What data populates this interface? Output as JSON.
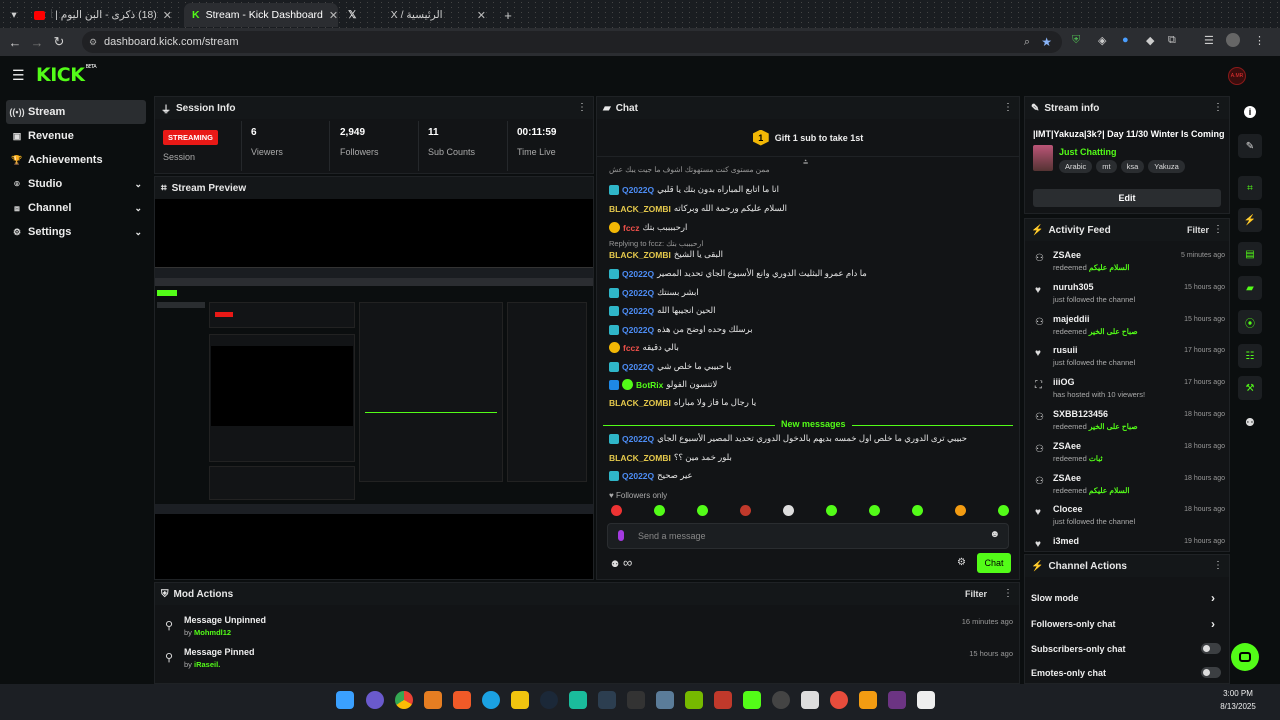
{
  "browser": {
    "tabs": [
      {
        "title": "(18) ذكرى - البن اليوم | ألبوم كامل"
      },
      {
        "title": "Stream - Kick Dashboard"
      },
      {
        "title": "الرئيسية / X"
      }
    ],
    "url": "dashboard.kick.com/stream"
  },
  "app": {
    "logo": "KICK",
    "logo_sup": "BETA",
    "avatar_label": "A.MR"
  },
  "sidebar": {
    "items": [
      {
        "label": "Stream",
        "icon": "radio-icon"
      },
      {
        "label": "Revenue",
        "icon": "wallet-icon"
      },
      {
        "label": "Achievements",
        "icon": "trophy-icon"
      },
      {
        "label": "Studio",
        "icon": "studio-icon"
      },
      {
        "label": "Channel",
        "icon": "channel-icon"
      },
      {
        "label": "Settings",
        "icon": "gear-icon"
      }
    ]
  },
  "session": {
    "title": "Session Info",
    "status_badge": "STREAMING",
    "status_label": "Session",
    "stats": [
      {
        "value": "6",
        "label": "Viewers"
      },
      {
        "value": "2,949",
        "label": "Followers"
      },
      {
        "value": "11",
        "label": "Sub Counts"
      },
      {
        "value": "00:11:59",
        "label": "Time Live"
      }
    ]
  },
  "preview": {
    "title": "Stream Preview"
  },
  "chat": {
    "title": "Chat",
    "gift_banner": "Gift 1 sub to take 1st",
    "gift_number": "1",
    "messages": [
      {
        "user": "",
        "text": "ممن مستوى كنت مستهوتك اشوف ما جيت يبك عش"
      },
      {
        "user": "Q2022Q",
        "text": "انا ما اتابع المباراه بدون بتك يا قلبي",
        "color": "blue"
      },
      {
        "user": "BLACK_ZOMBI",
        "text": "السلام عليكم ورحمة الله وبركاته",
        "color": "yellow"
      },
      {
        "user": "fccz",
        "text": "ارحببببب بتك",
        "color": "red"
      },
      {
        "user": "",
        "text": "Replying to fccz: ارحبببب بتك"
      },
      {
        "user": "BLACK_ZOMBI",
        "text": "البقى يا الشيخ",
        "color": "yellow"
      },
      {
        "user": "Q2022Q",
        "text": "ما دام عمرو البثليث الدوري وانع الأسبوع الجاي تحديد المصير",
        "color": "blue"
      },
      {
        "user": "Q2022Q",
        "text": "ابشر بسنتك",
        "color": "blue"
      },
      {
        "user": "Q2022Q",
        "text": "الحين انجيبها الله",
        "color": "blue"
      },
      {
        "user": "Q2022Q",
        "text": "برسلك وحده اوضح من هذه",
        "color": "blue"
      },
      {
        "user": "fccz",
        "text": "بالي دقيقه",
        "color": "red"
      },
      {
        "user": "Q2022Q",
        "text": "يا حبيبي ما خلص شي",
        "color": "blue"
      },
      {
        "user": "BotRix",
        "text": "لاتنسون الفولو",
        "color": "green"
      },
      {
        "user": "BLACK_ZOMBI",
        "text": "يا رجال ما فاز ولا مباراه",
        "color": "yellow"
      }
    ],
    "new_messages_label": "New messages",
    "new_messages": [
      {
        "user": "Q2022Q",
        "text": "حبيبي ترى الدوري ما خلص اول خمسه بديهم بالدخول الدوري تحديد المصير الأسبوع الجاي",
        "color": "blue"
      },
      {
        "user": "BLACK_ZOMBI",
        "text": "بلور خمد مين ؟؟",
        "color": "yellow"
      },
      {
        "user": "Q2022Q",
        "text": "عير صحيح",
        "color": "blue"
      }
    ],
    "followers_only": "Followers only",
    "input_placeholder": "Send a message",
    "send_label": "Chat",
    "infinity": "∞"
  },
  "stream_info": {
    "title": "Stream info",
    "stream_title": "|IMT|Yakuza|3k?| Day 11/30 Winter Is Coming",
    "category": "Just Chatting",
    "tags": [
      "Arabic",
      "mt",
      "ksa",
      "Yakuza"
    ],
    "edit_label": "Edit"
  },
  "activity": {
    "title": "Activity Feed",
    "filter_label": "Filter",
    "items": [
      {
        "name": "ZSAee",
        "action": "redeemed",
        "reward": "السلام عليكم",
        "time": "5 minutes ago",
        "icon": "reward-icon"
      },
      {
        "name": "nuruh305",
        "action": "just followed the channel",
        "reward": "",
        "time": "15 hours ago",
        "icon": "heart-icon"
      },
      {
        "name": "majeddii",
        "action": "redeemed",
        "reward": "صباح على الخير",
        "time": "15 hours ago",
        "icon": "reward-icon"
      },
      {
        "name": "rusuii",
        "action": "just followed the channel",
        "reward": "",
        "time": "17 hours ago",
        "icon": "heart-icon"
      },
      {
        "name": "iiiOG",
        "action": "has hosted with 10 viewers!",
        "reward": "",
        "time": "17 hours ago",
        "icon": "host-icon"
      },
      {
        "name": "SXBB123456",
        "action": "redeemed",
        "reward": "صباح على الخير",
        "time": "18 hours ago",
        "icon": "reward-icon"
      },
      {
        "name": "ZSAee",
        "action": "redeemed",
        "reward": "ثبات",
        "time": "18 hours ago",
        "icon": "reward-icon"
      },
      {
        "name": "ZSAee",
        "action": "redeemed",
        "reward": "السلام عليكم",
        "time": "18 hours ago",
        "icon": "reward-icon"
      },
      {
        "name": "Clocee",
        "action": "just followed the channel",
        "reward": "",
        "time": "18 hours ago",
        "icon": "heart-icon"
      },
      {
        "name": "i3med",
        "action": "",
        "reward": "",
        "time": "19 hours ago",
        "icon": "heart-icon"
      }
    ]
  },
  "channel_actions": {
    "title": "Channel Actions",
    "items": [
      {
        "label": "Slow mode",
        "control": "chevron"
      },
      {
        "label": "Followers-only chat",
        "control": "chevron"
      },
      {
        "label": "Subscribers-only chat",
        "control": "toggle"
      },
      {
        "label": "Emotes-only chat",
        "control": "toggle"
      }
    ]
  },
  "mod_actions": {
    "title": "Mod Actions",
    "filter_label": "Filter",
    "items": [
      {
        "action": "Message Unpinned",
        "by": "by",
        "user": "Mohmdl12",
        "time": "16 minutes ago"
      },
      {
        "action": "Message Pinned",
        "by": "by",
        "user": "iRaseil.",
        "time": "15 hours ago"
      }
    ]
  },
  "taskbar": {
    "time": "3:00 PM",
    "date": "8/13/2025"
  },
  "colors": {
    "accent": "#53fc18",
    "live": "#e91916",
    "panel": "#121416",
    "background": "#0b0e0f"
  }
}
